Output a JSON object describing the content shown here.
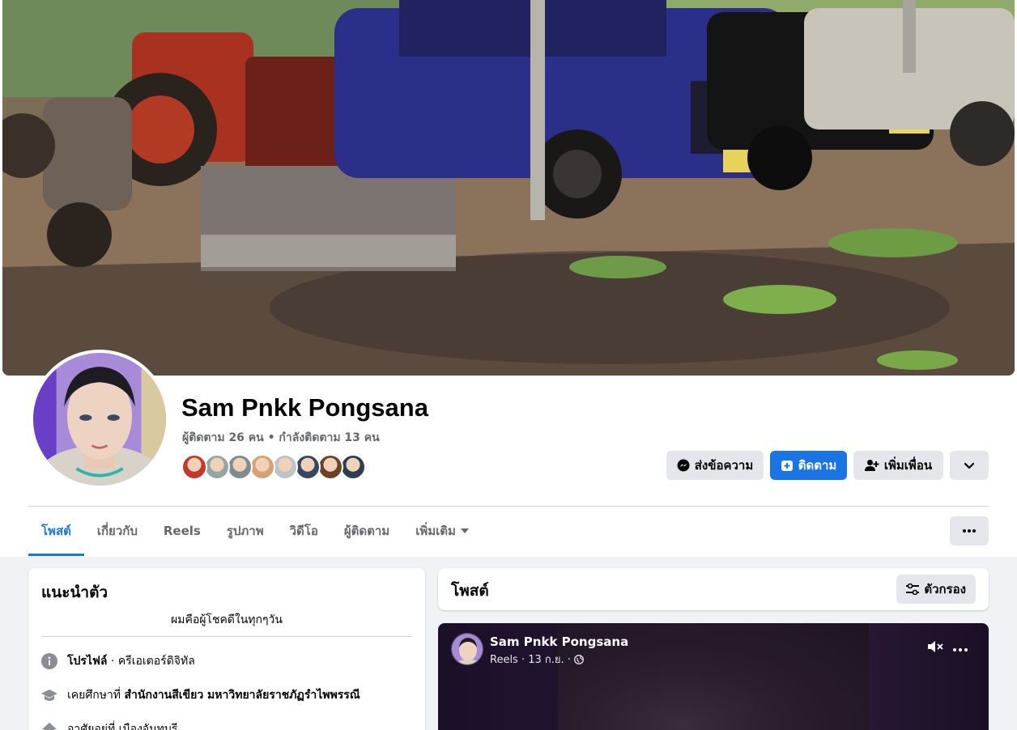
{
  "profile": {
    "name": "Sam Pnkk Pongsana",
    "stats": "ผู้ติดตาม 26 คน • กำลังติดตาม 13 คน",
    "friend_faces": [
      "#c0392b",
      "#95a5a6",
      "#7f8c8d",
      "#d4a373",
      "#bdc3c7",
      "#34495e",
      "#6b4226",
      "#2c3e50"
    ]
  },
  "actions": {
    "message": "ส่งข้อความ",
    "follow": "ติดตาม",
    "add_friend": "เพิ่มเพื่อน"
  },
  "tabs": [
    {
      "label": "โพสต์",
      "active": true
    },
    {
      "label": "เกี่ยวกับ",
      "active": false
    },
    {
      "label": "Reels",
      "active": false
    },
    {
      "label": "รูปภาพ",
      "active": false
    },
    {
      "label": "วิดีโอ",
      "active": false
    },
    {
      "label": "ผู้ติดตาม",
      "active": false
    },
    {
      "label": "เพิ่มเติม",
      "active": false
    }
  ],
  "intro": {
    "title": "แนะนำตัว",
    "bio": "ผมคือผู้โชคดีในทุกๆวัน",
    "profile_label": "โปรไฟล์",
    "profile_value": " · ครีเอเตอร์ดิจิทัล",
    "study_prefix": "เคยศึกษาที่ ",
    "study_value": "สำนักงานสีเขียว มหาวิทยาลัยราชภัฏรำไพพรรณี",
    "third_row": "อาศัยอยู่ที่ เมืองจันทบุรี"
  },
  "posts": {
    "title": "โพสต์",
    "filter": "ตัวกรอง"
  },
  "reel": {
    "author": "Sam Pnkk Pongsana",
    "meta": "Reels · 13 ก.ย. ·"
  },
  "colors": {
    "accent": "#1b74e4",
    "muted": "#65676b"
  }
}
